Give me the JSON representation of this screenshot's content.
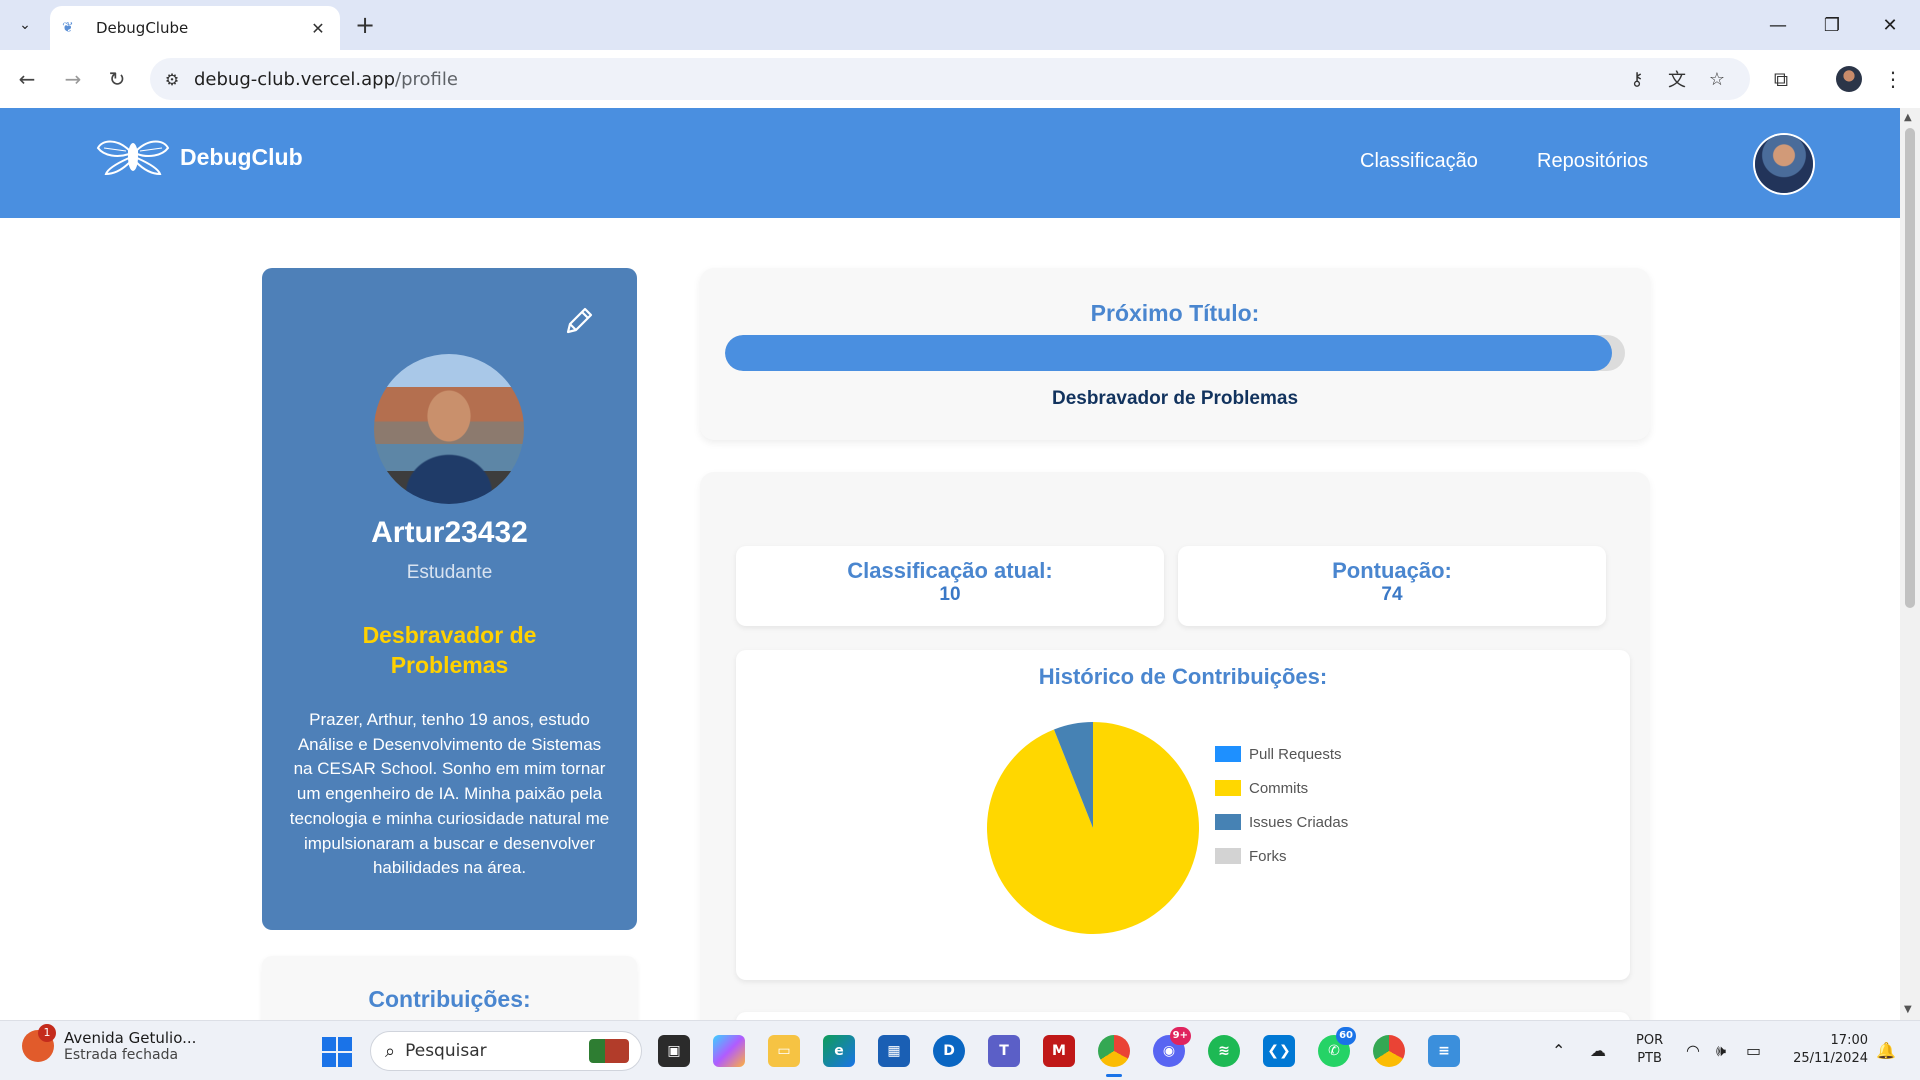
{
  "browser": {
    "tab_title": "DebugClube",
    "url_host": "debug-club.vercel.app",
    "url_path": "/profile"
  },
  "site": {
    "brand": "DebugClub",
    "nav": [
      "Classificação",
      "Repositórios"
    ],
    "accent_color": "#4a8fe0"
  },
  "profile": {
    "username": "Artur23432",
    "role": "Estudante",
    "rank_title": "Desbravador de Problemas",
    "bio": "Prazer, Arthur, tenho 19 anos, estudo Análise e Desenvolvimento de Sistemas na CESAR School. Sonho em mim tornar um engenheiro de IA. Minha paixão pela tecnologia e minha curiosidade natural me impulsionaram a buscar e desenvolver habilidades na área.",
    "contributions_heading": "Contribuições:"
  },
  "next_title": {
    "heading": "Próximo Título:",
    "progress_fraction": 0.985,
    "name": "Desbravador de Problemas"
  },
  "stats": {
    "rank_label": "Classificação atual:",
    "rank_value": "10",
    "score_label": "Pontuação:",
    "score_value": "74"
  },
  "chart_data": {
    "type": "pie",
    "title": "Histórico de Contribuições:",
    "categories": [
      "Pull Requests",
      "Commits",
      "Issues Criadas",
      "Forks"
    ],
    "values": [
      0,
      94,
      6,
      0
    ],
    "colors": [
      "#1e90ff",
      "#ffd700",
      "#4682b4",
      "#d3d3d3"
    ],
    "legend_position": "right"
  },
  "taskbar": {
    "weather_title": "Avenida Getulio...",
    "weather_subtitle": "Estrada fechada",
    "weather_badge": "1",
    "search_placeholder": "Pesquisar",
    "discord_badge": "9+",
    "whatsapp_badge": "60",
    "lang_top": "POR",
    "lang_bottom": "PTB",
    "time": "17:00",
    "date": "25/11/2024"
  }
}
